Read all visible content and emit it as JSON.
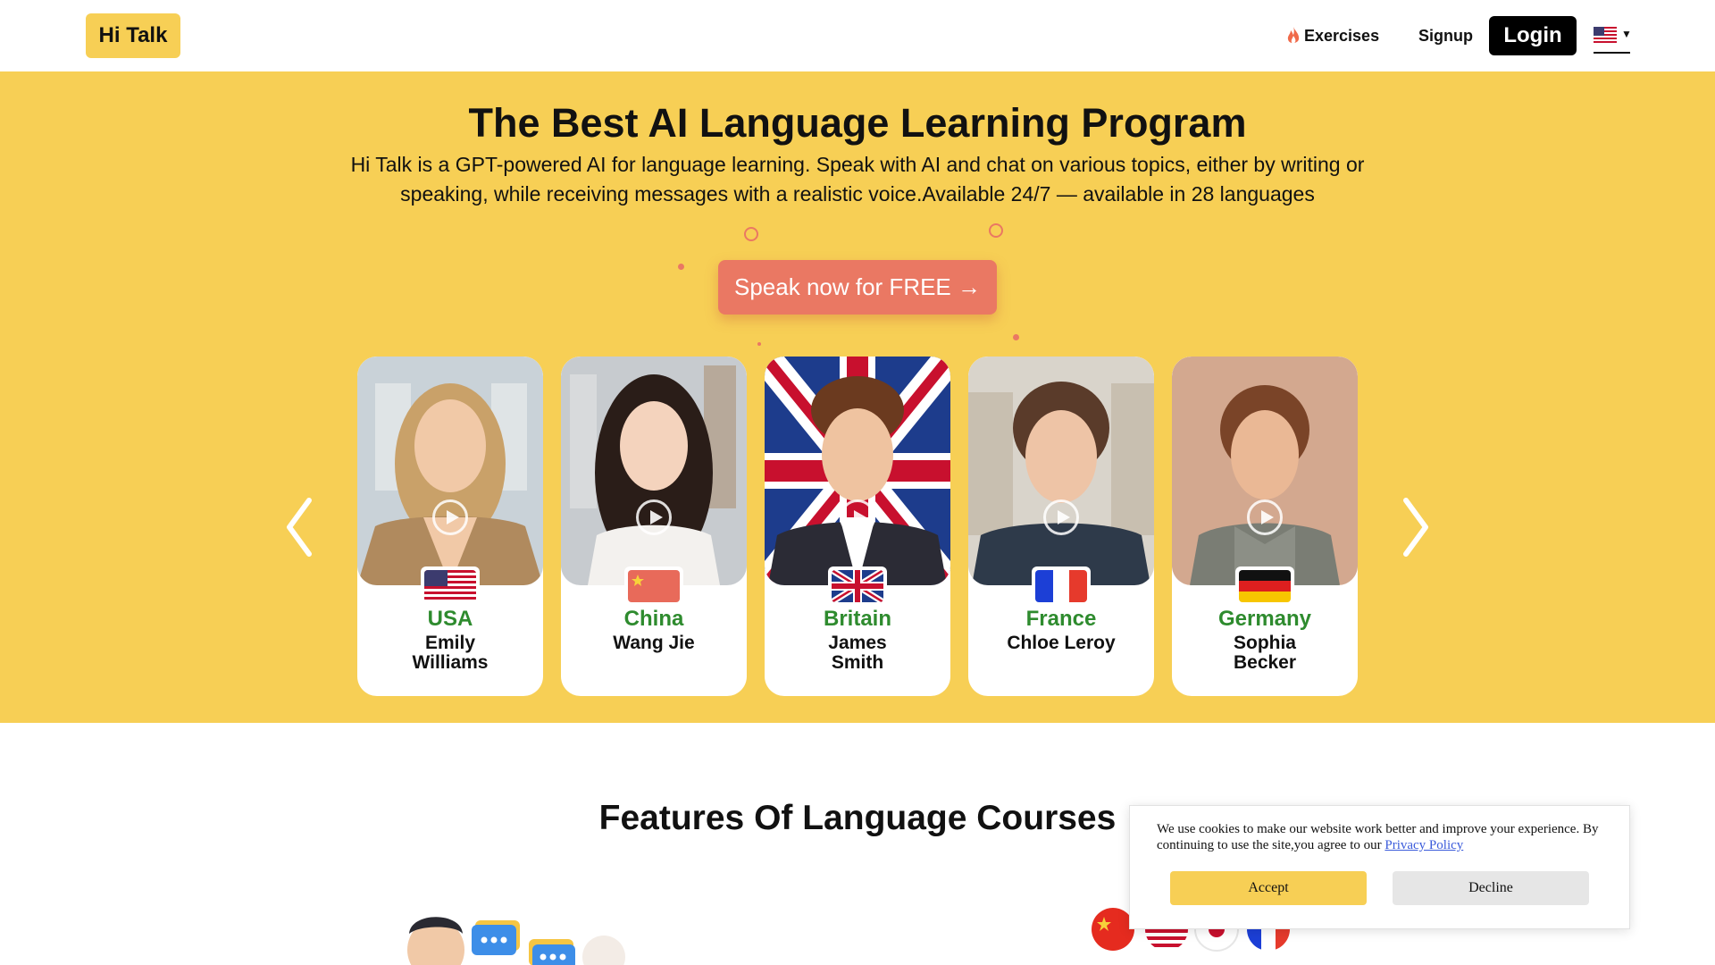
{
  "header": {
    "logo": "Hi Talk",
    "nav": {
      "exercises": "Exercises",
      "signup": "Signup",
      "login": "Login"
    },
    "language_flag": "us-flag-icon",
    "flame_icon": "flame-icon"
  },
  "hero": {
    "title": "The Best AI Language Learning Program",
    "subtitle": "Hi Talk is a GPT-powered AI for language learning. Speak with AI and chat on various topics, either by writing or speaking, while receiving messages with a realistic voice.Available 24/7 — available in 28 languages",
    "cta": "Speak now for FREE →",
    "bg_color": "#f7cf55",
    "cta_color": "#ea7863",
    "tutors": [
      {
        "country": "USA",
        "name": "Emily Williams",
        "flag": "us-flag-icon"
      },
      {
        "country": "China",
        "name": "Wang Jie",
        "flag": "cn-flag-icon"
      },
      {
        "country": "Britain",
        "name": "James Smith",
        "flag": "gb-flag-icon"
      },
      {
        "country": "France",
        "name": "Chloe Leroy",
        "flag": "fr-flag-icon"
      },
      {
        "country": "Germany",
        "name": "Sophia Becker",
        "flag": "de-flag-icon"
      }
    ]
  },
  "features": {
    "title": "Features Of Language Courses"
  },
  "cookie": {
    "text": "We use cookies to make our website work better and improve your experience. By continuing to use the site,you agree to our",
    "link": "Privacy Policy",
    "accept": "Accept",
    "decline": "Decline"
  }
}
